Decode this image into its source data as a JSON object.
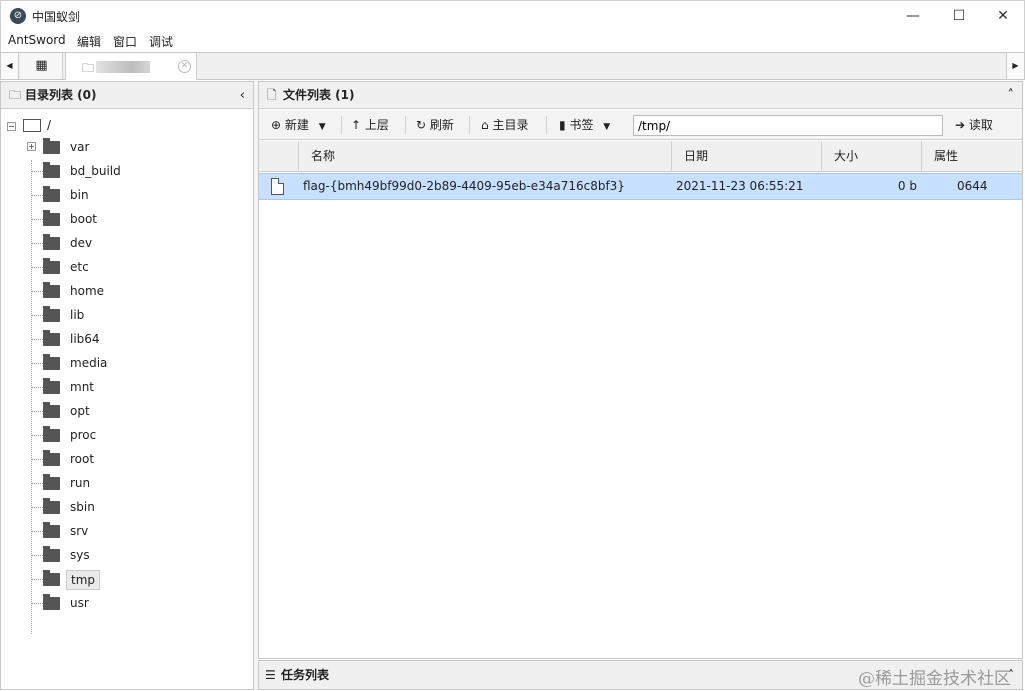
{
  "window": {
    "title": "中国蚁剑",
    "minimize": "—",
    "maximize": "☐",
    "close": "✕"
  },
  "menu": [
    "AntSword",
    "编辑",
    "窗口",
    "调试"
  ],
  "tabs": {
    "scroll_left": "◀",
    "scroll_right": "▶",
    "grid_icon": "▦",
    "shell_icon": "🗀",
    "close_icon": "✕"
  },
  "left_panel": {
    "title": "目录列表 (0)",
    "collapse": "‹",
    "root": "/",
    "items": [
      {
        "label": "var",
        "expandable": true
      },
      {
        "label": "bd_build"
      },
      {
        "label": "bin"
      },
      {
        "label": "boot"
      },
      {
        "label": "dev"
      },
      {
        "label": "etc"
      },
      {
        "label": "home"
      },
      {
        "label": "lib"
      },
      {
        "label": "lib64"
      },
      {
        "label": "media"
      },
      {
        "label": "mnt"
      },
      {
        "label": "opt"
      },
      {
        "label": "proc"
      },
      {
        "label": "root"
      },
      {
        "label": "run"
      },
      {
        "label": "sbin"
      },
      {
        "label": "srv"
      },
      {
        "label": "sys"
      },
      {
        "label": "tmp",
        "selected": true
      },
      {
        "label": "usr"
      }
    ]
  },
  "right_panel": {
    "title": "文件列表 (1)",
    "collapse": "˄",
    "toolbar": {
      "new": "新建",
      "up": "上层",
      "refresh": "刷新",
      "home": "主目录",
      "bookmark": "书签",
      "path": "/tmp/",
      "read": "读取"
    },
    "columns": [
      "名称",
      "日期",
      "大小",
      "属性"
    ],
    "rows": [
      {
        "name": "flag-{bmh49bf99d0-2b89-4409-95eb-e34a716c8bf3}",
        "date": "2021-11-23 06:55:21",
        "size": "0 b",
        "perm": "0644"
      }
    ]
  },
  "task_panel": {
    "title": "任务列表",
    "expand": "˄"
  },
  "watermark": "@稀土掘金技术社区"
}
